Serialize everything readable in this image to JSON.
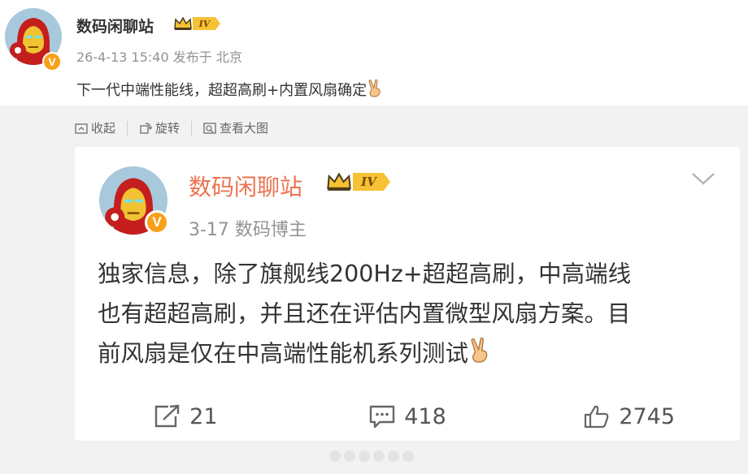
{
  "post": {
    "author": "数码闲聊站",
    "verified_mark": "V",
    "level": "IV",
    "meta": "26-4-13 15:40 发布于 北京",
    "text": "下一代中端性能线，超超高刷+内置风扇确定",
    "toolbar": {
      "collapse": "收起",
      "rotate": "旋转",
      "view_large": "查看大图"
    }
  },
  "retweet": {
    "author": "数码闲聊站",
    "verified_mark": "V",
    "level": "IV",
    "meta": "3-17  数码博主",
    "text_lines": [
      "独家信息，除了旗舰线200Hz+超超高刷，中高端线",
      "也有超超高刷，并且还在评估内置微型风扇方案。目",
      "前风扇是仅在中高端性能机系列测试"
    ],
    "actions": {
      "reposts": "21",
      "comments": "418",
      "likes": "2745"
    }
  },
  "colors": {
    "author_orange": "#eb7350",
    "badge_orange": "#f7a11a",
    "level_gold": "#f6c233",
    "meta_grey": "#939393",
    "background_grey": "#f2f2f2"
  },
  "icons": [
    "share-icon",
    "comment-icon",
    "like-icon",
    "collapse-icon",
    "rotate-icon",
    "zoom-icon",
    "chevron-down-icon",
    "crown-icon",
    "victory-hand-icon"
  ]
}
